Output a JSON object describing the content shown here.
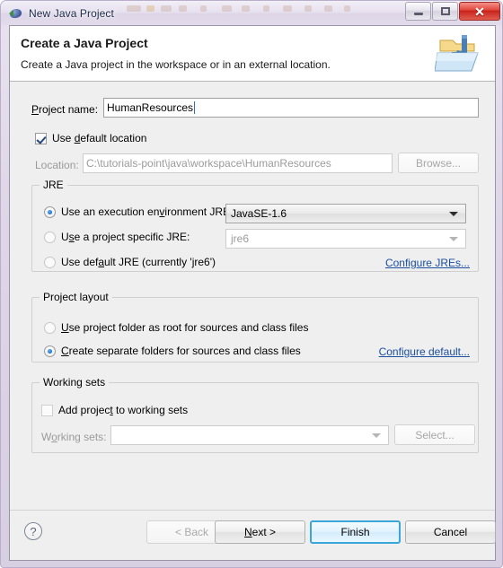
{
  "window": {
    "title": "New Java Project",
    "icon": "java-project-icon",
    "buttons": {
      "minimize": "minimize-button",
      "maximize": "maximize-button",
      "close": "✕"
    }
  },
  "header": {
    "title": "Create a Java Project",
    "subtitle": "Create a Java project in the workspace or in an external location.",
    "icon": "new-java-project-wizard-icon"
  },
  "form": {
    "project_name_label": "Project name:",
    "project_name_value": "HumanResources",
    "use_default_location_label": "Use default location",
    "use_default_location_checked": true,
    "location_label": "Location:",
    "location_value": "C:\\tutorials-point\\java\\workspace\\HumanResources",
    "browse_label": "Browse..."
  },
  "jre": {
    "group_title": "JRE",
    "options": [
      {
        "label": "Use an execution environment JRE:",
        "selected": true
      },
      {
        "label": "Use a project specific JRE:",
        "selected": false
      },
      {
        "label": "Use default JRE (currently 'jre6')",
        "selected": false
      }
    ],
    "execution_env_value": "JavaSE-1.6",
    "specific_jre_value": "jre6",
    "configure_link": "Configure JREs..."
  },
  "project_layout": {
    "group_title": "Project layout",
    "options": [
      {
        "label": "Use project folder as root for sources and class files",
        "selected": false
      },
      {
        "label": "Create separate folders for sources and class files",
        "selected": true
      }
    ],
    "configure_link": "Configure default..."
  },
  "working_sets": {
    "group_title": "Working sets",
    "add_label": "Add project to working sets",
    "add_checked": false,
    "working_sets_label": "Working sets:",
    "working_sets_value": "",
    "select_label": "Select..."
  },
  "footer": {
    "help": "?",
    "back": "< Back",
    "next": "Next >",
    "finish": "Finish",
    "cancel": "Cancel",
    "back_enabled": false,
    "default_button": "Finish"
  },
  "colors": {
    "accent": "#3aa5d8",
    "link": "#1b4fa0",
    "frame": "#ded6e6",
    "body": "#efefef",
    "close": "#c9231b"
  }
}
